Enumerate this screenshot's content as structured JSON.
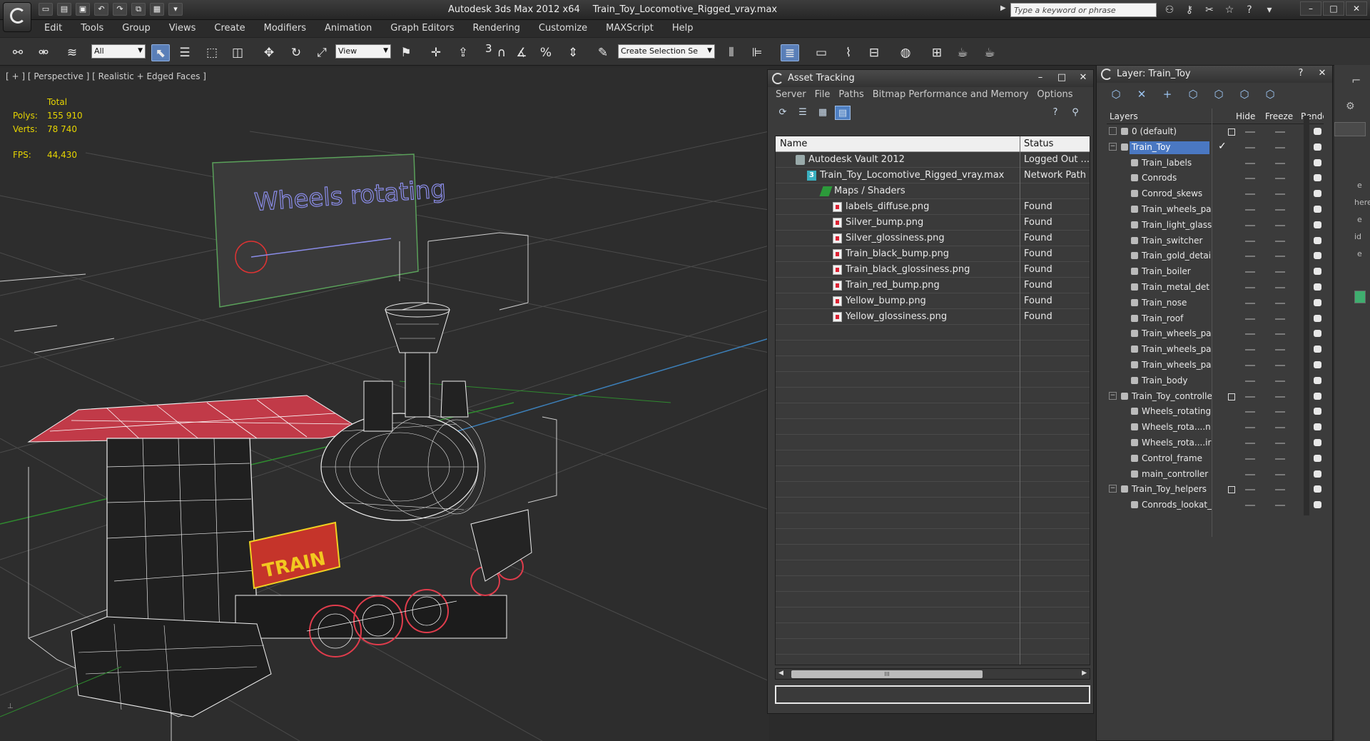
{
  "window": {
    "app_title": "Autodesk 3ds Max  2012 x64",
    "file_name": "Train_Toy_Locomotive_Rigged_vray.max",
    "search_placeholder": "Type a keyword or phrase",
    "minimize": "–",
    "maximize": "□",
    "close": "✕"
  },
  "menu": [
    "Edit",
    "Tools",
    "Group",
    "Views",
    "Create",
    "Modifiers",
    "Animation",
    "Graph Editors",
    "Rendering",
    "Customize",
    "MAXScript",
    "Help"
  ],
  "toolbar": {
    "selection_filter": "All",
    "reference_coord": "View",
    "named_selection_placeholder": "Create Selection Se",
    "snap_value": "3"
  },
  "viewport": {
    "label": "[ + ] [ Perspective ] [ Realistic + Edged Faces ]",
    "stats": {
      "total_label": "Total",
      "polys_label": "Polys:",
      "polys_value": "155 910",
      "verts_label": "Verts:",
      "verts_value": "78 740",
      "fps_label": "FPS:",
      "fps_value": "44,430"
    },
    "control_text": "Wheels rotating",
    "loco_plate": "TRAIN"
  },
  "asset_tracking": {
    "title": "Asset Tracking",
    "menu": [
      "Server",
      "File",
      "Paths",
      "Bitmap Performance and Memory",
      "Options"
    ],
    "col_name": "Name",
    "col_status": "Status",
    "rows": [
      {
        "name": "Autodesk Vault 2012",
        "status": "Logged Out ...",
        "indent": 0,
        "icon": "vault"
      },
      {
        "name": "Train_Toy_Locomotive_Rigged_vray.max",
        "status": "Network Path",
        "indent": 1,
        "icon": "max"
      },
      {
        "name": "Maps / Shaders",
        "status": "",
        "indent": 2,
        "icon": "maps"
      },
      {
        "name": "labels_diffuse.png",
        "status": "Found",
        "indent": 3,
        "icon": "file"
      },
      {
        "name": "Silver_bump.png",
        "status": "Found",
        "indent": 3,
        "icon": "file"
      },
      {
        "name": "Silver_glossiness.png",
        "status": "Found",
        "indent": 3,
        "icon": "file"
      },
      {
        "name": "Train_black_bump.png",
        "status": "Found",
        "indent": 3,
        "icon": "file"
      },
      {
        "name": "Train_black_glossiness.png",
        "status": "Found",
        "indent": 3,
        "icon": "file"
      },
      {
        "name": "Train_red_bump.png",
        "status": "Found",
        "indent": 3,
        "icon": "file"
      },
      {
        "name": "Yellow_bump.png",
        "status": "Found",
        "indent": 3,
        "icon": "file"
      },
      {
        "name": "Yellow_glossiness.png",
        "status": "Found",
        "indent": 3,
        "icon": "file"
      }
    ],
    "scroll_grip": "III"
  },
  "layer_window": {
    "title": "Layer: Train_Toy",
    "col_layers": "Layers",
    "col_hide": "Hide",
    "col_freeze": "Freeze",
    "col_render": "Rende",
    "rows": [
      {
        "name": "0 (default)",
        "level": 0,
        "selected": false,
        "current": false,
        "box": true
      },
      {
        "name": "Train_Toy",
        "level": 0,
        "selected": true,
        "current": true,
        "box": false
      },
      {
        "name": "Train_labels",
        "level": 1
      },
      {
        "name": "Conrods",
        "level": 1
      },
      {
        "name": "Conrod_skews",
        "level": 1
      },
      {
        "name": "Train_wheels_pa",
        "level": 1
      },
      {
        "name": "Train_light_glass",
        "level": 1
      },
      {
        "name": "Train_switcher",
        "level": 1
      },
      {
        "name": "Train_gold_detai",
        "level": 1
      },
      {
        "name": "Train_boiler",
        "level": 1
      },
      {
        "name": "Train_metal_det",
        "level": 1
      },
      {
        "name": "Train_nose",
        "level": 1
      },
      {
        "name": "Train_roof",
        "level": 1
      },
      {
        "name": "Train_wheels_pa",
        "level": 1
      },
      {
        "name": "Train_wheels_pa",
        "level": 1
      },
      {
        "name": "Train_wheels_pa",
        "level": 1
      },
      {
        "name": "Train_body",
        "level": 1
      },
      {
        "name": "Train_Toy_controlle",
        "level": 0,
        "box": true
      },
      {
        "name": "Wheels_rotating",
        "level": 1
      },
      {
        "name": "Wheels_rota....n",
        "level": 1
      },
      {
        "name": "Wheels_rota....ir",
        "level": 1
      },
      {
        "name": "Control_frame",
        "level": 1
      },
      {
        "name": "main_controller",
        "level": 1
      },
      {
        "name": "Train_Toy_helpers",
        "level": 0,
        "box": true
      },
      {
        "name": "Conrods_lookat_",
        "level": 1
      }
    ]
  },
  "right_panel": {
    "frag1": "e",
    "frag2": "here",
    "frag3": "e",
    "frag4": "id",
    "frag5": "e"
  },
  "colors": {
    "viewport_bg": "#2d2d2d",
    "stats_yellow": "#e6d400",
    "selection_blue": "#4a78c2",
    "wire_white": "#f0f0f0",
    "roof_red": "#d43a4a"
  }
}
